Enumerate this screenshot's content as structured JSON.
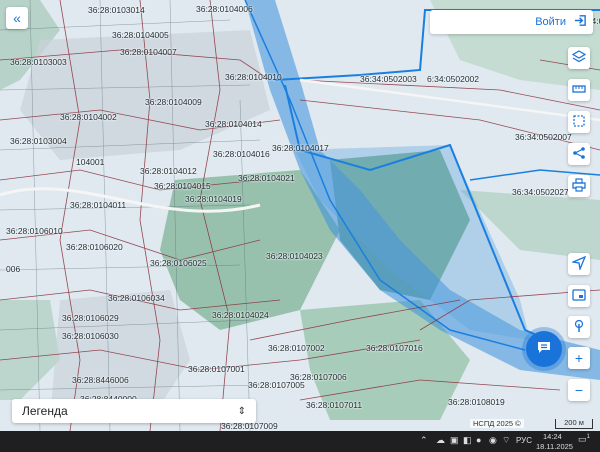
{
  "header": {
    "login_label": "Войти"
  },
  "legend": {
    "label": "Легенда"
  },
  "attribution": "НСПД 2025 ©",
  "scale_label": "200 м",
  "parcels": [
    "36:28:0103014",
    "36:28:0104006",
    "36:28:0104005",
    "36:28:0104007",
    "36:28:0103003",
    "36:28:0104010",
    "36:28:0104009",
    "36:34:0502003",
    "6:34:0502002",
    "36:28:0104002",
    "36:28:0104014",
    "36:28:0103004",
    "36:34:0502007",
    "36:28:0104016",
    "36:28:0104017",
    "104001",
    "36:28:0104012",
    "36:28:0104021",
    "36:28:0104015",
    "36:28:0104011",
    "36:28:0104019",
    "36:34:0502027",
    "36:28:0106010",
    "36:28:0106020",
    "36:28:0106025",
    "36:28:0104023",
    "006",
    "36:28:0106034",
    "36:28:0106029",
    "36:28:0104024",
    "36:28:0106030",
    "36:28:0107002",
    "36:28:0107016",
    "36:28:0107001",
    "36:28:8446006",
    "36:28:0107006",
    "36:28:0107005",
    "36:28:8440000",
    "36:28:0107011",
    "36:28:0108019",
    "36:28:0107009",
    "36:34:0"
  ],
  "controls": {
    "collapse": "chevrons-left-icon",
    "layers": "layers-icon",
    "measure": "ruler-icon",
    "select": "selection-icon",
    "share": "share-icon",
    "print": "printer-icon",
    "locate": "navigation-arrow-icon",
    "card": "card-icon",
    "touch": "touch-icon",
    "zoom_in": "+",
    "zoom_out": "−",
    "chat": "chat-icon"
  },
  "taskbar": {
    "lang": "РУС",
    "time": "14:24",
    "date": "18.11.2025",
    "notif": "1"
  },
  "colors": {
    "water": "#3a8fdb",
    "green": "#6fa88a",
    "boundary": "#1a7fe0",
    "parcel_line": "#8a2d3a",
    "accent": "#1a73d9"
  }
}
